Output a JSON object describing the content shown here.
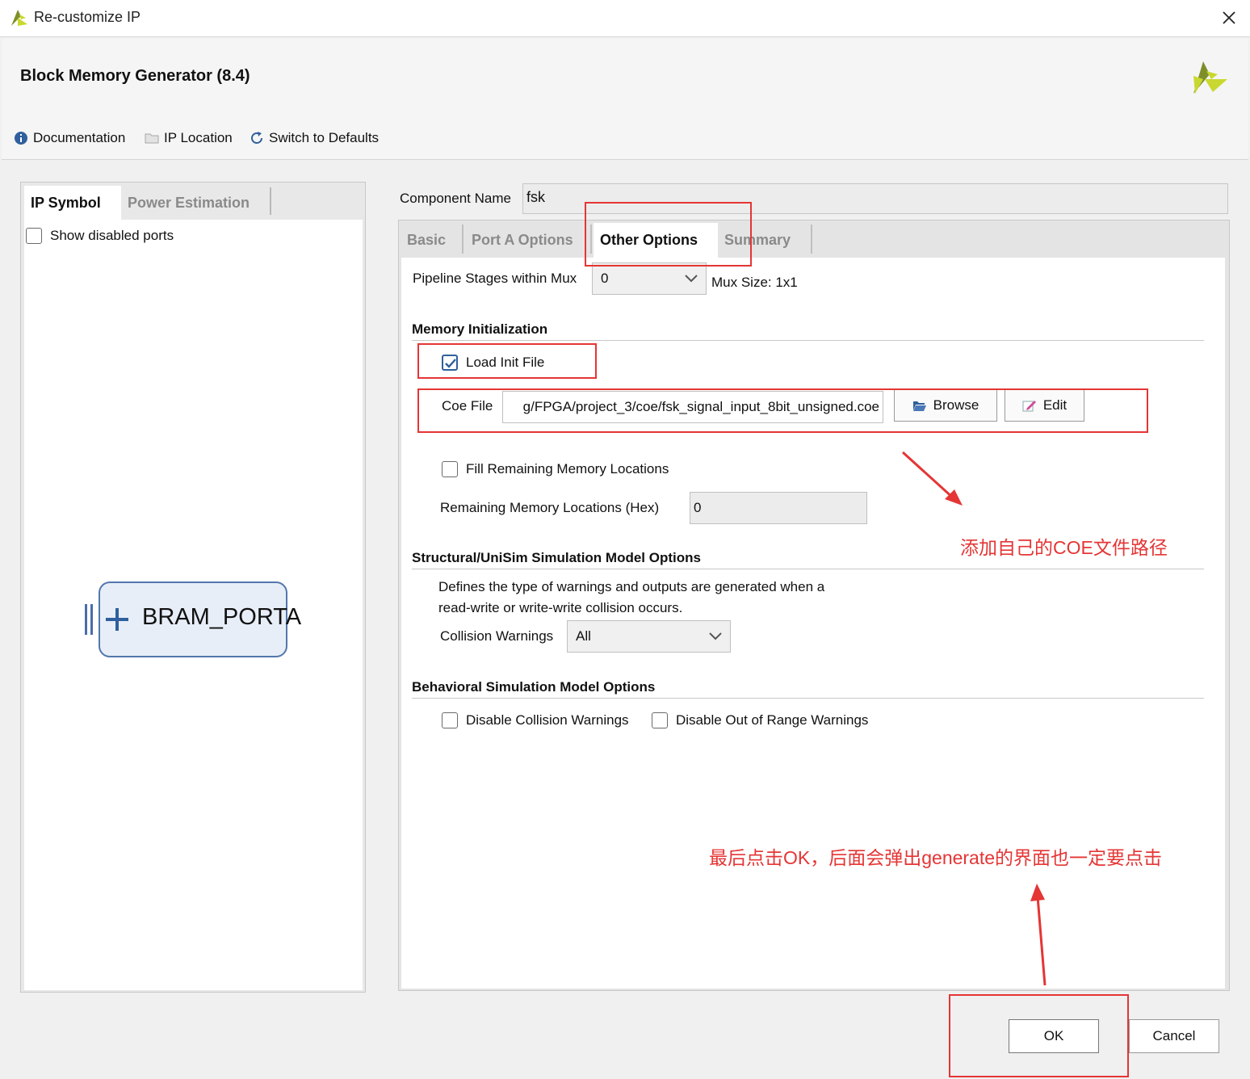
{
  "window": {
    "title": "Re-customize IP",
    "close_glyph": "✕"
  },
  "header": {
    "ip_name": "Block Memory Generator (8.4)",
    "links": [
      {
        "label": "Documentation",
        "icon": "info-icon"
      },
      {
        "label": "IP Location",
        "icon": "folder-icon"
      },
      {
        "label": "Switch to Defaults",
        "icon": "refresh-icon"
      }
    ]
  },
  "left_panel": {
    "tabs": [
      "IP Symbol",
      "Power Estimation"
    ],
    "active_tab": "IP Symbol",
    "show_disabled_ports": {
      "label": "Show disabled ports",
      "checked": false
    },
    "symbol": {
      "port_label": "BRAM_PORTA"
    }
  },
  "component": {
    "label": "Component Name",
    "value": "fsk"
  },
  "tabs": {
    "items": [
      "Basic",
      "Port A Options",
      "Other Options",
      "Summary"
    ],
    "active": "Other Options"
  },
  "other_options": {
    "pipeline": {
      "label": "Pipeline Stages within Mux",
      "value": "0",
      "mux_size": "Mux Size: 1x1"
    },
    "memory_init": {
      "title": "Memory Initialization",
      "load_init": {
        "label": "Load Init File",
        "checked": true
      },
      "coe": {
        "label": "Coe File",
        "value": "g/FPGA/project_3/coe/fsk_signal_input_8bit_unsigned.coe",
        "browse_label": "Browse",
        "edit_label": "Edit"
      },
      "fill_remaining": {
        "label": "Fill Remaining Memory Locations",
        "checked": false
      },
      "remaining": {
        "label": "Remaining Memory Locations (Hex)",
        "value": "0"
      }
    },
    "structural": {
      "title": "Structural/UniSim Simulation Model Options",
      "description_line1": "Defines the type of warnings and outputs are generated when a",
      "description_line2": "read-write or write-write collision occurs.",
      "collision": {
        "label": "Collision Warnings",
        "value": "All"
      }
    },
    "behavioral": {
      "title": "Behavioral Simulation Model Options",
      "disable_collision": {
        "label": "Disable Collision Warnings",
        "checked": false
      },
      "disable_out_of_range": {
        "label": "Disable Out of Range Warnings",
        "checked": false
      }
    }
  },
  "footer": {
    "ok_label": "OK",
    "cancel_label": "Cancel"
  },
  "annotations": {
    "coe_note": "添加自己的COE文件路径",
    "ok_note": "最后点击OK，后面会弹出generate的界面也一定要点击",
    "color": "#e53535"
  },
  "colors": {
    "accent_blue": "#2f5f9c",
    "logo_yellow": "#c9d830",
    "logo_green": "#7e8f2a",
    "annotation_red": "#e53535"
  }
}
